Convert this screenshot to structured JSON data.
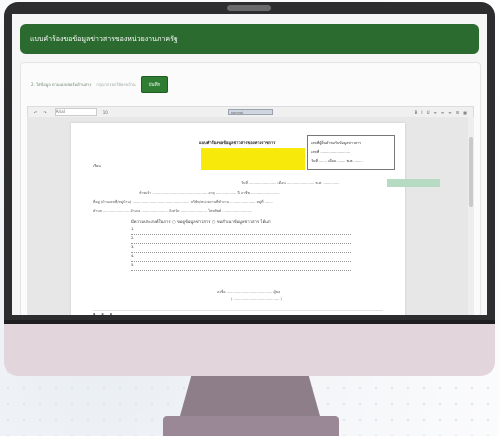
{
  "app": {
    "header_title": "แบบคำร้องขอข้อมูลข่าวสารของหน่วยงานภาครัฐ",
    "step_label": "2. ใส่ข้อมูล ตามแบบฟอร์มด้านล่าง",
    "step_sub": "กรุณากรอกให้ครบถ้วน",
    "save_button": "บันทึก"
  },
  "editor": {
    "font_name": "Arial",
    "font_size": "10",
    "style_name": "normal",
    "toolbar_icons": [
      "bold-icon",
      "italic-icon",
      "underline-icon",
      "align-left-icon",
      "align-center-icon",
      "align-right-icon",
      "list-icon",
      "table-icon"
    ]
  },
  "document": {
    "title": "แบบคำร้องขอข้อมูลข่าวสารของทางราชการ",
    "ref_box": [
      "เลขที่ผู้ยื่นคำขอรับข้อมูลข่าวสาร",
      "เลขที่ ..........................",
      "วันที่ ....... เดือน ....... พ.ศ. ......."
    ],
    "to_label": "เรียน",
    "lines": [
      "วันที่ ........................ เดือน ........................ พ.ศ. ..............",
      "ข้าพเจ้า ................................................ อายุ .................. ปี อาชีพ .........................",
      "ที่อยู่ (บ้านเลขที่/หมู่บ้าน) .................................................. บริษัท/หน่วยงานที่ทำงาน ...................... หมู่ที่ .......",
      "ตำบล ....................... อำเภอ ....................... จังหวัด ....................... โทรศัพท์ .........................."
    ],
    "request_text": "มีความประสงค์ในการ   ○ ขอดูข้อมูลข่าวสาร   ○ ขอสำเนาข้อมูลข่าวสาร   ได้แก่",
    "body_numbers": [
      "1.",
      "2.",
      "3.",
      "4.",
      "5."
    ],
    "signature_label": "ลงชื่อ ........................................ ผู้ขอ",
    "signature_sub": "( ........................................ )"
  },
  "colors": {
    "header_green": "#2c6b2f",
    "highlight_yellow": "#f7ea0b",
    "tag_green": "#b5dcc2"
  }
}
